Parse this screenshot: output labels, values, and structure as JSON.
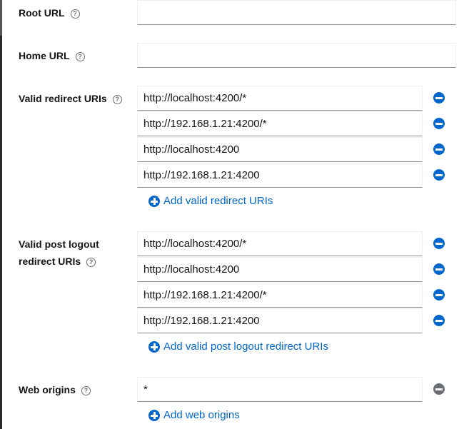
{
  "root_url": {
    "label": "Root URL",
    "value": ""
  },
  "home_url": {
    "label": "Home URL",
    "value": ""
  },
  "valid_redirect": {
    "label": "Valid redirect URIs",
    "values": [
      "http://localhost:4200/*",
      "http://192.168.1.21:4200/*",
      "http://localhost:4200",
      "http://192.168.1.21:4200"
    ],
    "add_label": "Add valid redirect URIs"
  },
  "post_logout": {
    "label_line1": "Valid post logout",
    "label_line2": "redirect URIs",
    "values": [
      "http://localhost:4200/*",
      "http://localhost:4200",
      "http://192.168.1.21:4200/*",
      "http://192.168.1.21:4200"
    ],
    "add_label": "Add valid post logout redirect URIs"
  },
  "web_origins": {
    "label": "Web origins",
    "values": [
      "*"
    ],
    "add_label": "Add web origins"
  },
  "help_glyph": "?",
  "colors": {
    "accent": "#0066cc",
    "disabled": "#6a6e73"
  }
}
